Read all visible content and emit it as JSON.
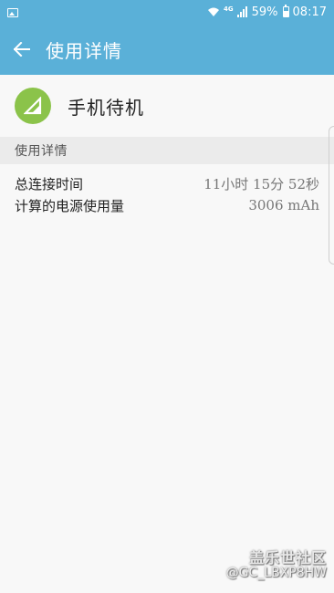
{
  "status_bar": {
    "network": "4G",
    "battery": "59%",
    "time": "08:17",
    "icons": [
      "gallery-icon",
      "wifi-icon",
      "signal-icon",
      "battery-icon"
    ]
  },
  "app_bar": {
    "title": "使用详情",
    "back_icon": "back-arrow-icon"
  },
  "app_header": {
    "icon": "signal-standby-icon",
    "icon_color": "#8bc34a",
    "name": "手机待机"
  },
  "section": {
    "title": "使用详情"
  },
  "details": [
    {
      "label": "总连接时间",
      "value": "11小时 15分 52秒"
    },
    {
      "label": "计算的电源使用量",
      "value": "3006 mAh"
    }
  ],
  "watermark": {
    "title": "盖乐世社区",
    "user": "@GC_LBXP8HW"
  },
  "colors": {
    "accent": "#5ab0d8",
    "background": "#f8f8f8",
    "section_bg": "#ebebeb"
  }
}
